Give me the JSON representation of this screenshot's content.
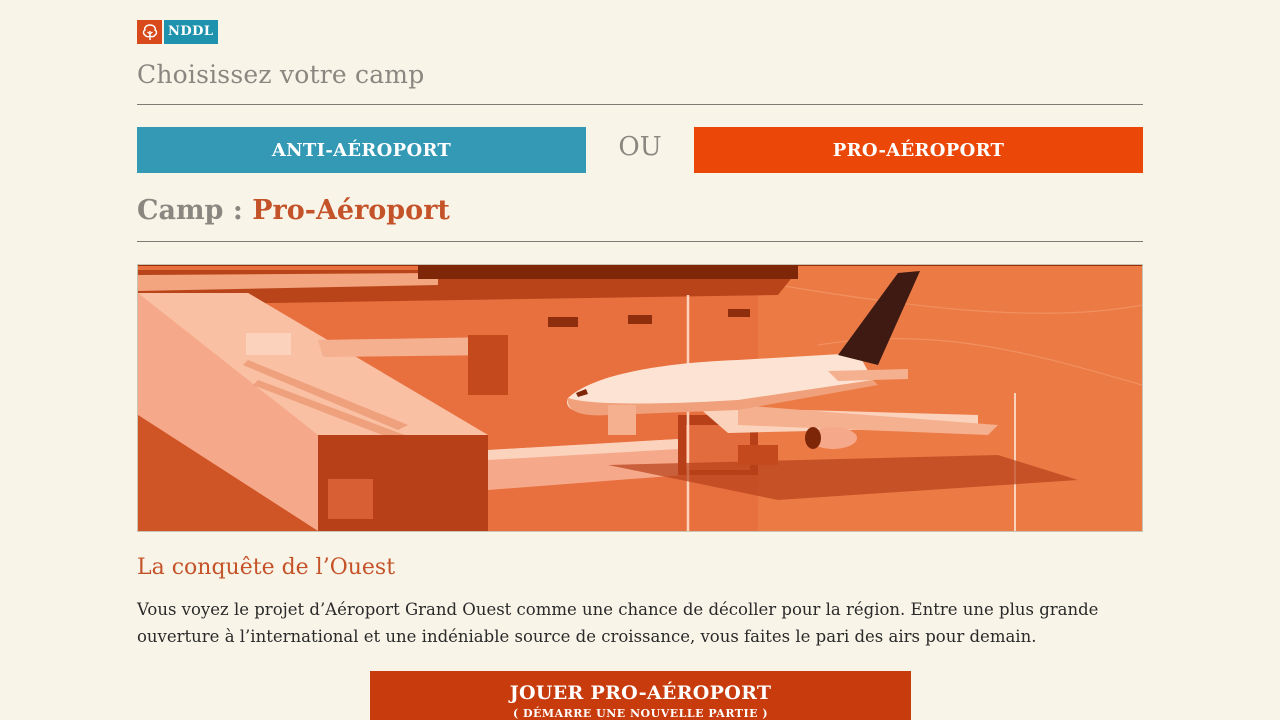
{
  "logo": {
    "text": "NDDL",
    "icon": "tree-icon",
    "colors": {
      "mark": "#d84a1b",
      "text_bg": "#1f93ad"
    }
  },
  "choose": {
    "title": "Choisissez votre camp"
  },
  "camps": {
    "anti_label": "ANTI-AÉROPORT",
    "or_label": "OU",
    "pro_label": "PRO-AÉROPORT",
    "colors": {
      "anti": "#3399b4",
      "pro": "#ea4708"
    }
  },
  "camp_header": {
    "prefix": "Camp : ",
    "name": "Pro-Aéroport"
  },
  "banner": {
    "subject": "airport-terminal-with-airplane",
    "tint": "#e4683a"
  },
  "article": {
    "title": "La conquête de l’Ouest",
    "body": "Vous voyez le projet d’Aéroport Grand Ouest comme une chance de décoller pour la région. Entre une plus grande ouverture à l’international et une indéniable source de croissance, vous faites le pari des airs pour demain."
  },
  "play": {
    "label": "JOUER PRO-AÉROPORT",
    "sublabel": "( DÉMARRE UNE NOUVELLE PARTIE )",
    "color": "#c83b0c"
  }
}
